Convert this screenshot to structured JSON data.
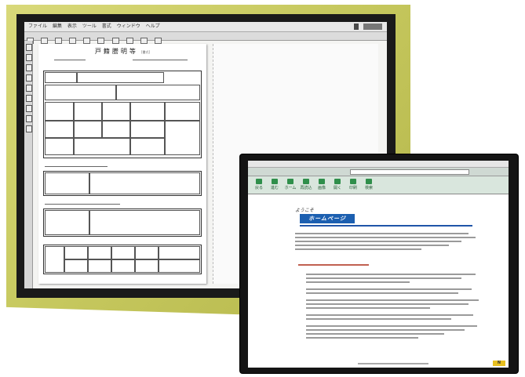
{
  "monitor_left": {
    "menubar": {
      "items": [
        "ファイル",
        "編集",
        "表示",
        "ツール",
        "書式",
        "ウィンドウ",
        "ヘルプ"
      ]
    },
    "document": {
      "title": "戸籍謄明等",
      "title_suffix": "[書式]"
    }
  },
  "monitor_right": {
    "nav_buttons": [
      "戻る",
      "進む",
      "ホーム",
      "再読込",
      "画像",
      "開く",
      "印刷",
      "検索"
    ],
    "site_logo_caption": "ようこそ",
    "site_logo": "ホームページ",
    "badge": "N"
  }
}
